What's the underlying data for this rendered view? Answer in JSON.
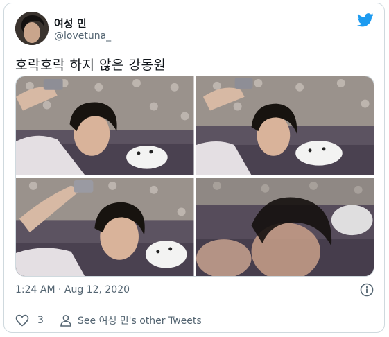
{
  "author": {
    "display_name": "여성 민",
    "handle": "@lovetuna_"
  },
  "tweet": {
    "text": "호락호락 하지 않은 강동원",
    "timestamp": "1:24 AM · Aug 12, 2020",
    "like_count": "3",
    "other_tweets_label": "See 여성 민's other Tweets"
  },
  "icons": {
    "brand": "twitter-bird-icon",
    "info": "info-icon",
    "like": "heart-icon",
    "profile": "person-icon"
  },
  "colors": {
    "twitter_blue": "#1d9bf0",
    "secondary_text": "#536471",
    "border": "#cfd9de"
  },
  "media": {
    "photo_count": 4
  }
}
